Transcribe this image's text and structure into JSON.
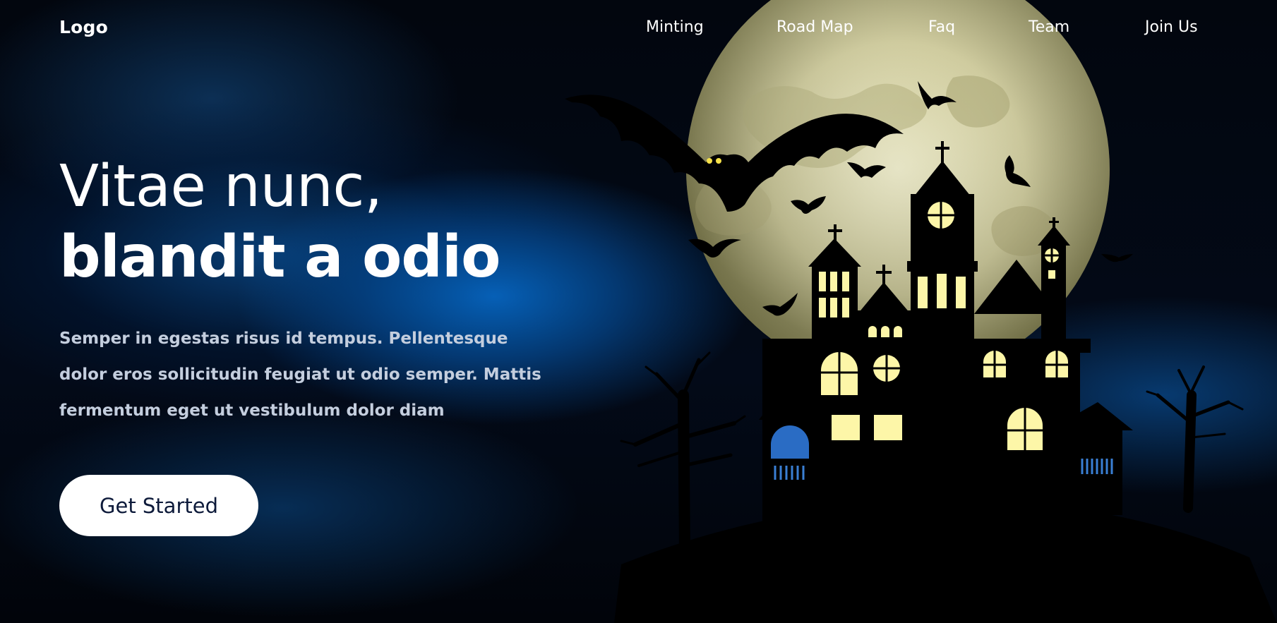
{
  "nav": {
    "logo": "Logo",
    "links": [
      "Minting",
      "Road Map",
      "Faq",
      "Team",
      "Join Us"
    ]
  },
  "hero": {
    "headline_line1": "Vitae nunc,",
    "headline_line2": "blandit a odio",
    "subtitle": "Semper in egestas risus id tempus. Pellentesque dolor eros sollicitudin feugiat ut odio semper. Mattis fermentum eget ut vestibulum dolor diam",
    "cta_label": "Get Started"
  },
  "colors": {
    "background": "#02060e",
    "glow_blue": "#0664be",
    "moon": "#c9c596",
    "window_light": "#fdf6a8",
    "cta_text": "#0d1a3a"
  }
}
